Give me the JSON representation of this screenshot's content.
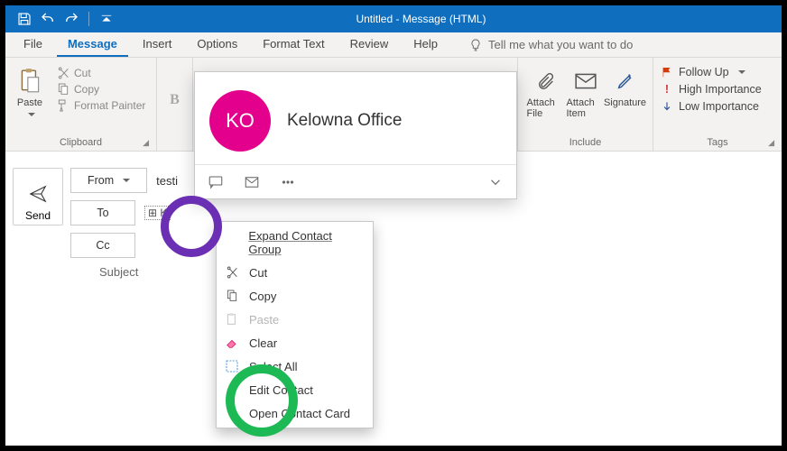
{
  "window": {
    "title": "Untitled  -  Message (HTML)"
  },
  "tabs": {
    "file": "File",
    "message": "Message",
    "insert": "Insert",
    "options": "Options",
    "formattext": "Format Text",
    "review": "Review",
    "help": "Help",
    "tellme": "Tell me what you want to do"
  },
  "ribbon": {
    "clipboard": {
      "paste": "Paste",
      "cut": "Cut",
      "copy": "Copy",
      "formatpainter": "Format Painter",
      "label": "Clipboard"
    },
    "font": {
      "bold": "B"
    },
    "include": {
      "attachfile": "Attach File",
      "attachitem": "Attach Item",
      "signature": "Signature",
      "label": "Include"
    },
    "tags": {
      "followup": "Follow Up",
      "high": "High Importance",
      "low": "Low Importance",
      "label": "Tags"
    }
  },
  "compose": {
    "send": "Send",
    "from": "From",
    "from_value": "testi",
    "to": "To",
    "to_value": "K",
    "cc": "Cc",
    "subject": "Subject"
  },
  "popover": {
    "initials": "KO",
    "name": "Kelowna Office"
  },
  "contextmenu": {
    "expand": "Expand Contact Group",
    "cut": "Cut",
    "copy": "Copy",
    "paste": "Paste",
    "clear": "Clear",
    "selectall": "Select All",
    "editcontact": "Edit Contact",
    "opencard": "Open Contact Card"
  }
}
